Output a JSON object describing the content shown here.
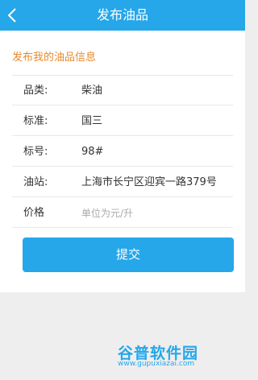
{
  "header": {
    "title": "发布油品",
    "back_icon": "chevron-left-icon"
  },
  "section": {
    "title": "发布我的油品信息"
  },
  "fields": [
    {
      "label": "品类:",
      "value": "柴油"
    },
    {
      "label": "标准:",
      "value": "国三"
    },
    {
      "label": "标号:",
      "value": "98#"
    },
    {
      "label": "油站:",
      "value": "上海市长宁区迎宾一路379号"
    },
    {
      "label": "价格",
      "value": "",
      "placeholder": "单位为元/升"
    }
  ],
  "submit_label": "提交",
  "watermark": {
    "logo": "谷普软件园",
    "url": "www.gupuxiazai.com"
  },
  "colors": {
    "accent": "#25a7ea",
    "section_title": "#e8892b",
    "background": "#eeeeee"
  }
}
